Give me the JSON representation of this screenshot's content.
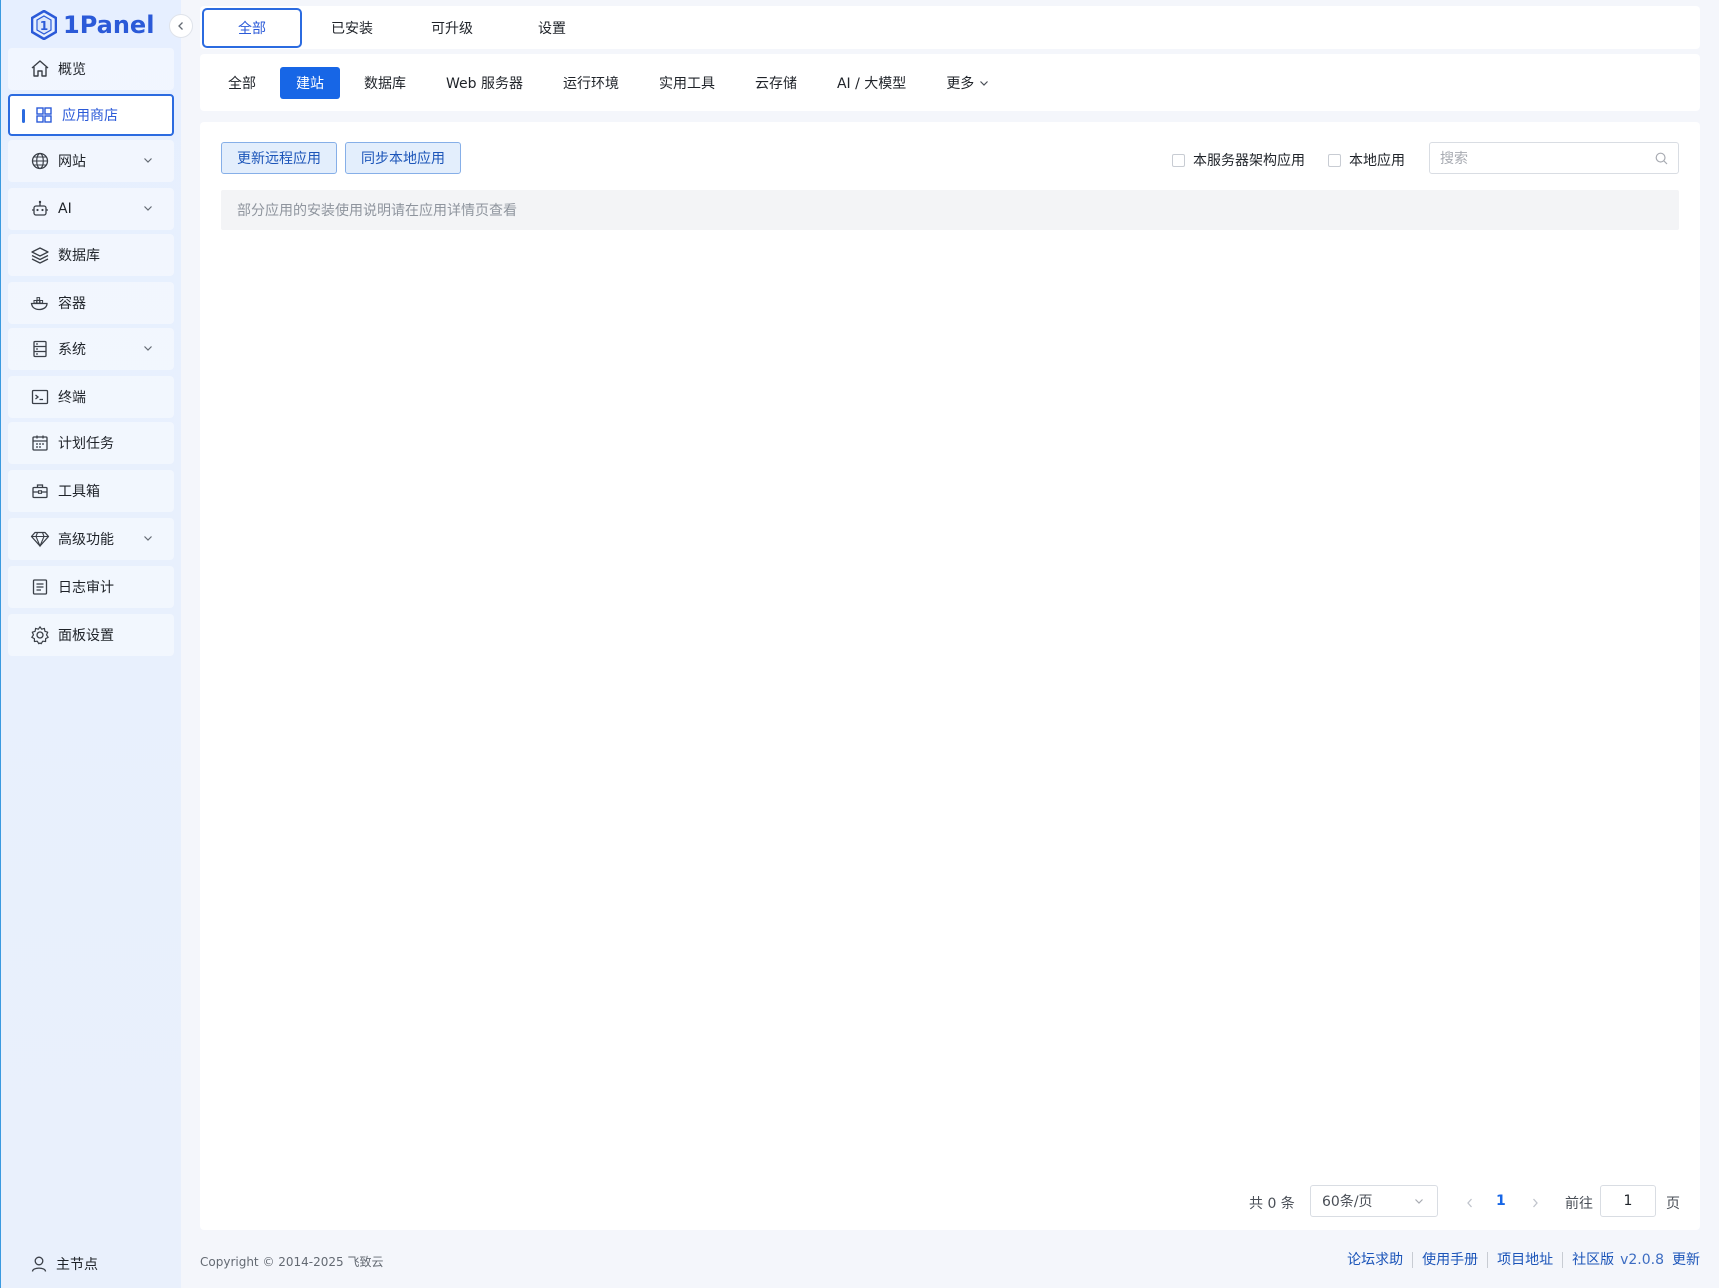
{
  "app": {
    "logo_text": "1Panel"
  },
  "sidebar": {
    "items": [
      {
        "label": "概览",
        "icon": "home-icon",
        "has_arrow": false
      },
      {
        "label": "应用商店",
        "icon": "grid-icon",
        "has_arrow": false
      },
      {
        "label": "网站",
        "icon": "globe-icon",
        "has_arrow": true
      },
      {
        "label": "AI",
        "icon": "robot-icon",
        "has_arrow": true
      },
      {
        "label": "数据库",
        "icon": "layers-icon",
        "has_arrow": false
      },
      {
        "label": "容器",
        "icon": "docker-icon",
        "has_arrow": false
      },
      {
        "label": "系统",
        "icon": "server-icon",
        "has_arrow": true
      },
      {
        "label": "终端",
        "icon": "terminal-icon",
        "has_arrow": false
      },
      {
        "label": "计划任务",
        "icon": "calendar-icon",
        "has_arrow": false
      },
      {
        "label": "工具箱",
        "icon": "toolbox-icon",
        "has_arrow": false
      },
      {
        "label": "高级功能",
        "icon": "diamond-icon",
        "has_arrow": true
      },
      {
        "label": "日志审计",
        "icon": "log-icon",
        "has_arrow": false
      },
      {
        "label": "面板设置",
        "icon": "gear-icon",
        "has_arrow": false
      }
    ],
    "active_index": 1,
    "footer_label": "主节点"
  },
  "top_tabs": [
    {
      "label": "全部",
      "active": true
    },
    {
      "label": "已安装",
      "active": false
    },
    {
      "label": "可升级",
      "active": false
    },
    {
      "label": "设置",
      "active": false
    }
  ],
  "categories": [
    {
      "label": "全部",
      "active": false
    },
    {
      "label": "建站",
      "active": true
    },
    {
      "label": "数据库",
      "active": false
    },
    {
      "label": "Web 服务器",
      "active": false
    },
    {
      "label": "运行环境",
      "active": false
    },
    {
      "label": "实用工具",
      "active": false
    },
    {
      "label": "云存储",
      "active": false
    },
    {
      "label": "AI / 大模型",
      "active": false
    },
    {
      "label": "更多",
      "active": false
    }
  ],
  "toolbar": {
    "update_remote_label": "更新远程应用",
    "sync_local_label": "同步本地应用",
    "arch_checkbox_label": "本服务器架构应用",
    "local_checkbox_label": "本地应用",
    "search_placeholder": "搜索"
  },
  "notice": "部分应用的安装使用说明请在应用详情页查看",
  "pagination": {
    "total_text": "共 0 条",
    "page_size": "60条/页",
    "current_page": "1",
    "goto_label": "前往",
    "goto_value": "1",
    "page_suffix": "页"
  },
  "footer": {
    "copyright": "Copyright © 2014-2025 飞致云",
    "links": [
      "论坛求助",
      "使用手册",
      "项目地址",
      "社区版"
    ],
    "version": "v2.0.8",
    "update_label": "更新"
  },
  "colors": {
    "accent": "#2b6be0",
    "active_tab_bg": "#1766e6",
    "link": "#1c55b9"
  }
}
